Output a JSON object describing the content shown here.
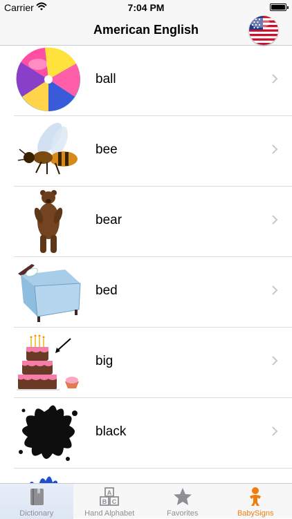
{
  "status_bar": {
    "carrier": "Carrier",
    "time": "7:04 PM"
  },
  "nav": {
    "title": "American English",
    "flag_icon": "us-flag-icon"
  },
  "list": {
    "items": [
      {
        "label": "ball",
        "icon": "beach-ball-image"
      },
      {
        "label": "bee",
        "icon": "bee-image"
      },
      {
        "label": "bear",
        "icon": "bear-image"
      },
      {
        "label": "bed",
        "icon": "bed-image"
      },
      {
        "label": "big",
        "icon": "big-cake-image"
      },
      {
        "label": "black",
        "icon": "black-splat-image"
      },
      {
        "label": "",
        "icon": "blue-splat-image"
      }
    ]
  },
  "tabs": [
    {
      "label": "Dictionary",
      "icon": "book-icon"
    },
    {
      "label": "Hand Alphabet",
      "icon": "abc-blocks-icon"
    },
    {
      "label": "Favorites",
      "icon": "star-icon"
    },
    {
      "label": "BabySigns",
      "icon": "baby-icon",
      "active": true
    }
  ],
  "colors": {
    "accent": "#f07d10",
    "inactive": "#8e8e93",
    "chevron": "#c7c7cc"
  }
}
